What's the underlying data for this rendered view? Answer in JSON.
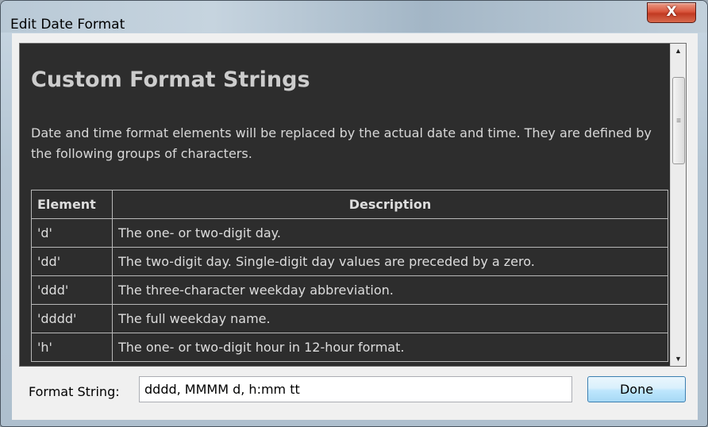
{
  "window": {
    "title": "Edit Date Format",
    "close_label": "X"
  },
  "doc": {
    "heading": "Custom Format Strings",
    "intro": "Date and time format elements will be replaced by the actual date and time. They are defined by the following groups of characters.",
    "table": {
      "headers": [
        "Element",
        "Description"
      ],
      "rows": [
        [
          "'d'",
          "The one- or two-digit day."
        ],
        [
          "'dd'",
          "The two-digit day. Single-digit day values are preceded by a zero."
        ],
        [
          "'ddd'",
          "The three-character weekday abbreviation."
        ],
        [
          "'dddd'",
          "The full weekday name."
        ],
        [
          "'h'",
          "The one- or two-digit hour in 12-hour format."
        ]
      ]
    }
  },
  "scrollbar": {
    "up_icon": "▲",
    "down_icon": "▼",
    "grip_icon": "≡"
  },
  "footer": {
    "format_label": "Format String:",
    "format_value": "dddd, MMMM d, h:mm tt",
    "done_label": "Done"
  }
}
